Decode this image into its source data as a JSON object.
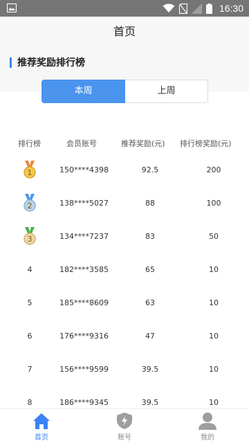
{
  "status_bar": {
    "time": "16:30"
  },
  "header": {
    "title": "首页"
  },
  "section": {
    "title": "推荐奖励排行榜"
  },
  "tabs": [
    {
      "label": "本周",
      "active": true
    },
    {
      "label": "上周",
      "active": false
    }
  ],
  "table": {
    "headers": [
      "排行榜",
      "会员账号",
      "推荐奖励(元)",
      "排行榜奖励(元)"
    ],
    "rows": [
      {
        "rank": "1",
        "medal": "gold-medal-icon",
        "account": "150****4398",
        "reward": "92.5",
        "bonus": "200"
      },
      {
        "rank": "2",
        "medal": "silver-medal-icon",
        "account": "138****5027",
        "reward": "88",
        "bonus": "100"
      },
      {
        "rank": "3",
        "medal": "bronze-medal-icon",
        "account": "134****7237",
        "reward": "83",
        "bonus": "50"
      },
      {
        "rank": "4",
        "account": "182****3585",
        "reward": "65",
        "bonus": "10"
      },
      {
        "rank": "5",
        "account": "185****8609",
        "reward": "63",
        "bonus": "10"
      },
      {
        "rank": "6",
        "account": "176****9316",
        "reward": "47",
        "bonus": "10"
      },
      {
        "rank": "7",
        "account": "156****9599",
        "reward": "39.5",
        "bonus": "10"
      },
      {
        "rank": "8",
        "account": "186****9345",
        "reward": "39.5",
        "bonus": "10"
      }
    ]
  },
  "bottom_nav": [
    {
      "label": "首页",
      "icon": "home-icon",
      "active": true
    },
    {
      "label": "账号",
      "icon": "shield-bolt-icon",
      "active": false
    },
    {
      "label": "我的",
      "icon": "user-icon",
      "active": false
    }
  ],
  "colors": {
    "accent": "#4a94ee",
    "nav_active": "#3b82f6",
    "status_bar": "#757575"
  }
}
